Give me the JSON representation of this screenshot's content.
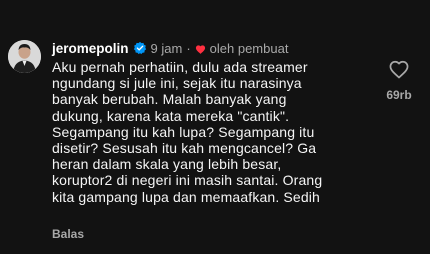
{
  "comment": {
    "username": "jeromepolin",
    "time": "9 jam",
    "separator": "·",
    "liked_by": "oleh pembuat",
    "text": "Aku pernah perhatiin, dulu ada streamer\nngundang si jule ini, sejak itu narasinya\nbanyak berubah. Malah banyak yang\ndukung, karena kata mereka \"cantik\".\nSegampang itu kah lupa? Segampang itu\ndisetir? Sesusah itu kah mengcancel? Ga\nheran dalam skala yang lebih besar,\nkoruptor2 di negeri ini masih santai. Orang\nkita gampang lupa dan memaafkan. Sedih",
    "like_count": "69rb",
    "reply_label": "Balas"
  },
  "colors": {
    "background": "#121212",
    "text": "#f5f5f5",
    "muted": "#a8a8a8",
    "heart_red": "#ff3040",
    "verified_blue": "#0095f6"
  },
  "icons": {
    "verified": "verified-badge-icon",
    "liked_heart": "heart-filled-icon",
    "like": "heart-outline-icon"
  }
}
